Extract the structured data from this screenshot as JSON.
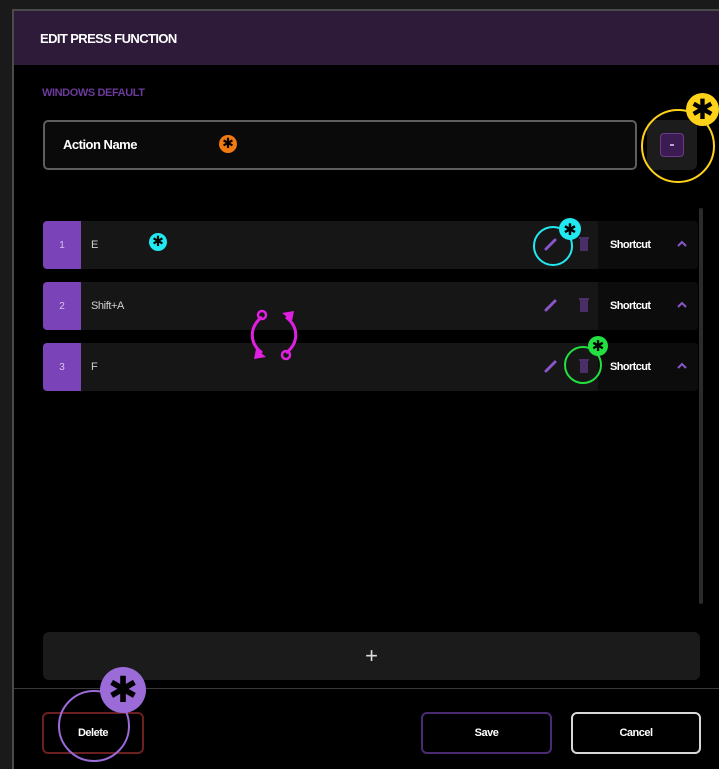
{
  "dialog": {
    "title": "EDIT PRESS FUNCTION",
    "section_label": "WINDOWS DEFAULT",
    "action_name_value": "Action Name"
  },
  "rows": [
    {
      "index": "1",
      "value": "E",
      "type": "Shortcut"
    },
    {
      "index": "2",
      "value": "Shift+A",
      "type": "Shortcut"
    },
    {
      "index": "3",
      "value": "F",
      "type": "Shortcut"
    }
  ],
  "add_button": {
    "label": "+"
  },
  "footer": {
    "delete_label": "Delete",
    "save_label": "Save",
    "cancel_label": "Cancel"
  },
  "icons": {
    "edit": "pencil-icon",
    "remove": "trash-icon",
    "expand": "chevron-up-icon",
    "icon_picker": "icon-picker-icon"
  },
  "colors": {
    "accent": "#7b43b8",
    "header_bg": "#2e1b3a",
    "delete_border": "#6b1f1f",
    "save_border": "#4b2a74"
  },
  "annotations": {
    "star_glyph": "✱",
    "yellow": "#ffd21a",
    "orange": "#f07a10",
    "cyan": "#22e8f0",
    "green": "#22e040",
    "magenta": "#e020e0",
    "violet": "#9b6bd8"
  }
}
